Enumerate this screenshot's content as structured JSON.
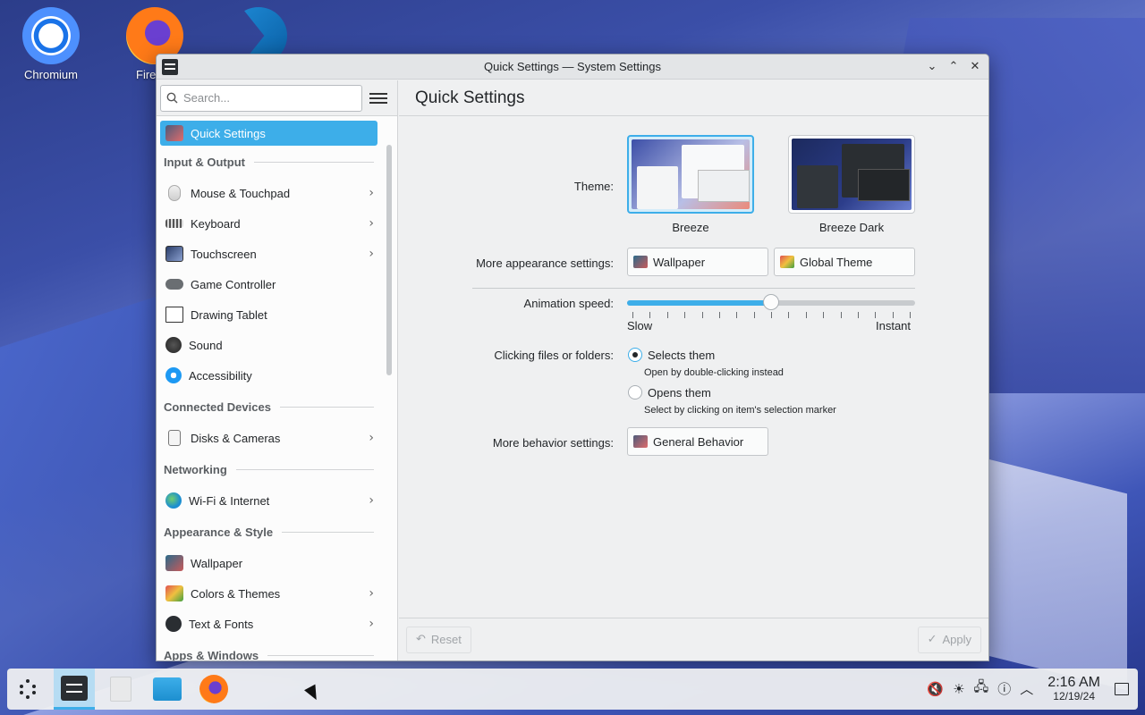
{
  "desktop": {
    "icons": [
      {
        "label": "Chromium"
      },
      {
        "label": "Fire"
      },
      {
        "label": ""
      }
    ]
  },
  "window": {
    "title": "Quick Settings — System Settings",
    "search_placeholder": "Search...",
    "page_title": "Quick Settings"
  },
  "sidebar": {
    "selected": "Quick Settings",
    "sections": [
      {
        "category": "Input & Output",
        "items": [
          {
            "label": "Mouse & Touchpad",
            "icon": "mouse-icon",
            "chevron": true
          },
          {
            "label": "Keyboard",
            "icon": "keyboard-icon",
            "chevron": true
          },
          {
            "label": "Touchscreen",
            "icon": "touchscreen-icon",
            "chevron": true
          },
          {
            "label": "Game Controller",
            "icon": "gamepad-icon",
            "chevron": false
          },
          {
            "label": "Drawing Tablet",
            "icon": "tablet-icon",
            "chevron": false
          },
          {
            "label": "Sound",
            "icon": "speaker-icon",
            "chevron": false
          },
          {
            "label": "Accessibility",
            "icon": "accessibility-icon",
            "chevron": false
          }
        ]
      },
      {
        "category": "Connected Devices",
        "items": [
          {
            "label": "Disks & Cameras",
            "icon": "disk-icon",
            "chevron": true
          }
        ]
      },
      {
        "category": "Networking",
        "items": [
          {
            "label": "Wi-Fi & Internet",
            "icon": "globe-icon",
            "chevron": true
          }
        ]
      },
      {
        "category": "Appearance & Style",
        "items": [
          {
            "label": "Wallpaper",
            "icon": "wallpaper-icon",
            "chevron": false
          },
          {
            "label": "Colors & Themes",
            "icon": "colors-icon",
            "chevron": true
          },
          {
            "label": "Text & Fonts",
            "icon": "fonts-icon",
            "chevron": true
          }
        ]
      },
      {
        "category": "Apps & Windows",
        "items": []
      }
    ]
  },
  "quick_settings": {
    "theme_label": "Theme:",
    "themes": [
      "Breeze",
      "Breeze Dark"
    ],
    "selected_theme": "Breeze",
    "more_appearance_label": "More appearance settings:",
    "wallpaper_button": "Wallpaper",
    "global_theme_button": "Global Theme",
    "animation_label": "Animation speed:",
    "animation_slow": "Slow",
    "animation_instant": "Instant",
    "animation_value": 0.5,
    "clicking_label": "Clicking files or folders:",
    "option_select": "Selects them",
    "option_select_hint": "Open by double-clicking instead",
    "option_open": "Opens them",
    "option_open_hint": "Select by clicking on item's selection marker",
    "selected_click_option": "Selects them",
    "more_behavior_label": "More behavior settings:",
    "general_behavior_button": "General Behavior",
    "reset_button": "Reset",
    "apply_button": "Apply"
  },
  "taskbar": {
    "time": "2:16 AM",
    "date": "12/19/24"
  },
  "colors": {
    "accent": "#3daee9",
    "window_bg": "#eff0f1",
    "sidebar_bg": "#fcfcfc"
  }
}
